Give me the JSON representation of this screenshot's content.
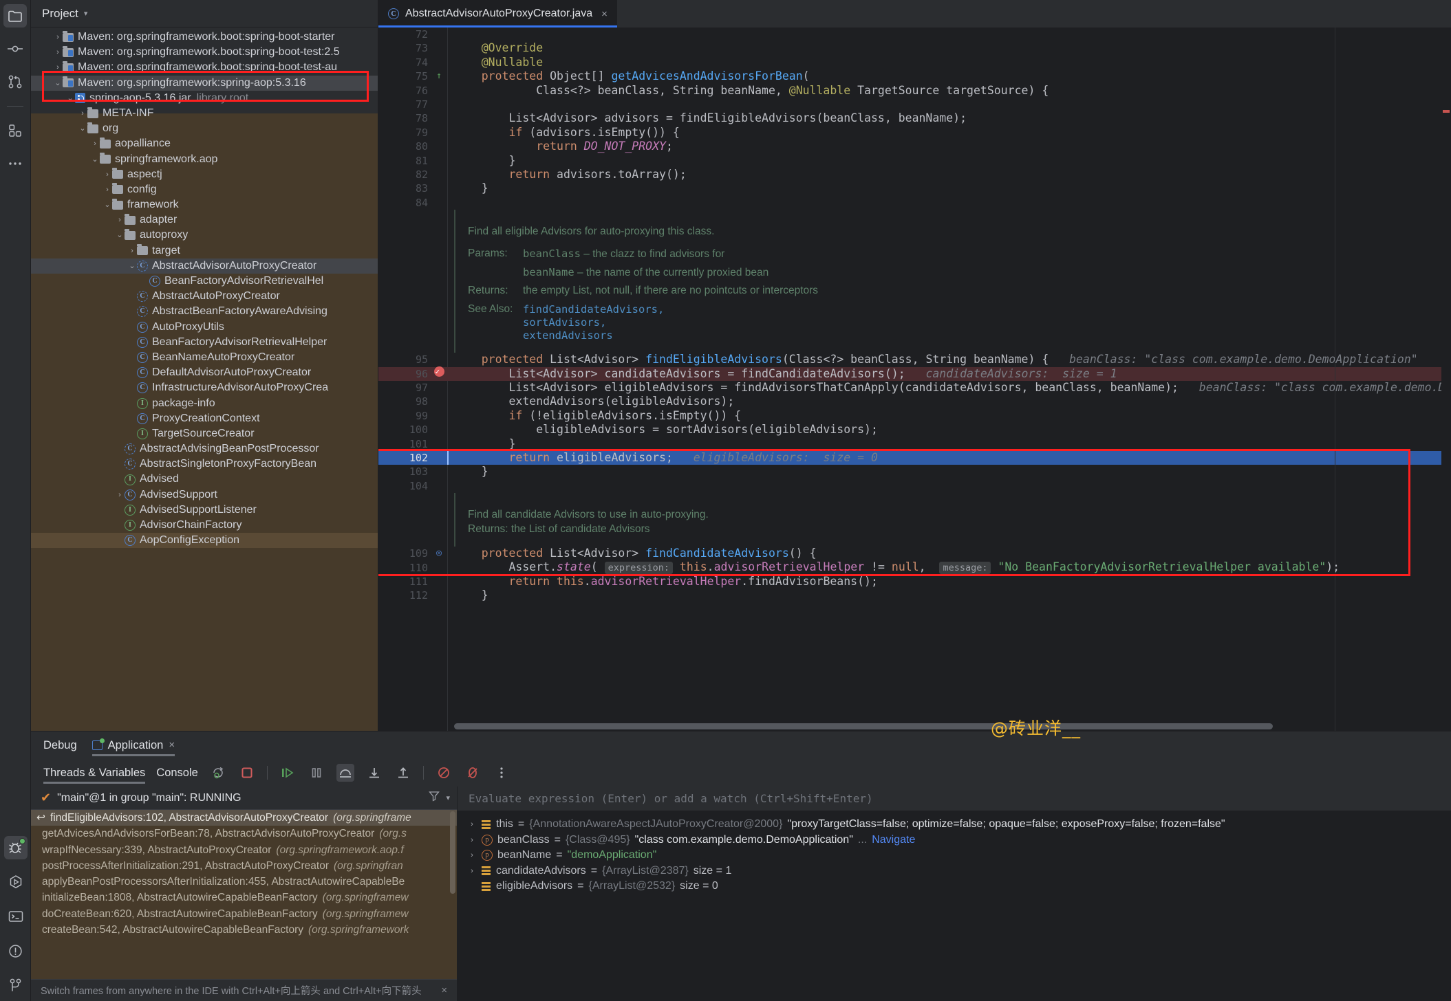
{
  "rail": {
    "top_items": [
      {
        "name": "project-icon",
        "glyph": "folder"
      },
      {
        "name": "commit-icon",
        "glyph": "commit"
      },
      {
        "name": "pull-requests-icon",
        "glyph": "branch"
      },
      {
        "name": "services-icon",
        "glyph": "grid"
      },
      {
        "name": "more-icon",
        "glyph": "dots"
      }
    ],
    "bottom_items": [
      {
        "name": "debug-icon",
        "glyph": "bug"
      },
      {
        "name": "run-icon",
        "glyph": "run"
      },
      {
        "name": "terminal-icon",
        "glyph": "terminal"
      },
      {
        "name": "problems-icon",
        "glyph": "problems"
      },
      {
        "name": "version-control-icon",
        "glyph": "vcs"
      }
    ]
  },
  "project": {
    "title": "Project",
    "tree": [
      {
        "indent": 1,
        "arrow": "collapsed",
        "icon": "maven-folder",
        "label": "Maven: org.springframework.boot:spring-boot-starter",
        "sub": ""
      },
      {
        "indent": 1,
        "arrow": "collapsed",
        "icon": "maven-folder",
        "label": "Maven: org.springframework.boot:spring-boot-test:2.5",
        "sub": ""
      },
      {
        "indent": 1,
        "arrow": "collapsed",
        "icon": "maven-folder",
        "label": "Maven: org.springframework.boot:spring-boot-test-au",
        "sub": ""
      },
      {
        "indent": 1,
        "arrow": "expanded",
        "icon": "maven-folder",
        "label": "Maven: org.springframework:spring-aop:5.3.16",
        "sub": "",
        "selected": "blue"
      },
      {
        "indent": 2,
        "arrow": "expanded",
        "icon": "jar",
        "label": "spring-aop-5.3.16.jar",
        "sub": "library root"
      },
      {
        "indent": 3,
        "arrow": "collapsed",
        "icon": "folder",
        "label": "META-INF",
        "sub": ""
      },
      {
        "indent": 3,
        "arrow": "expanded",
        "icon": "folder",
        "label": "org",
        "sub": ""
      },
      {
        "indent": 4,
        "arrow": "collapsed",
        "icon": "folder",
        "label": "aopalliance",
        "sub": ""
      },
      {
        "indent": 4,
        "arrow": "expanded",
        "icon": "folder",
        "label": "springframework.aop",
        "sub": ""
      },
      {
        "indent": 5,
        "arrow": "collapsed",
        "icon": "folder",
        "label": "aspectj",
        "sub": ""
      },
      {
        "indent": 5,
        "arrow": "collapsed",
        "icon": "folder",
        "label": "config",
        "sub": ""
      },
      {
        "indent": 5,
        "arrow": "expanded",
        "icon": "folder",
        "label": "framework",
        "sub": ""
      },
      {
        "indent": 6,
        "arrow": "collapsed",
        "icon": "folder",
        "label": "adapter",
        "sub": ""
      },
      {
        "indent": 6,
        "arrow": "expanded",
        "icon": "folder",
        "label": "autoproxy",
        "sub": ""
      },
      {
        "indent": 7,
        "arrow": "collapsed",
        "icon": "folder",
        "label": "target",
        "sub": ""
      },
      {
        "indent": 7,
        "arrow": "expanded",
        "icon": "class-abstract",
        "label": "AbstractAdvisorAutoProxyCreator",
        "sub": "",
        "selected": "gray"
      },
      {
        "indent": 8,
        "arrow": "none",
        "icon": "class",
        "label": "BeanFactoryAdvisorRetrievalHel",
        "sub": ""
      },
      {
        "indent": 7,
        "arrow": "none",
        "icon": "class-abstract",
        "label": "AbstractAutoProxyCreator",
        "sub": ""
      },
      {
        "indent": 7,
        "arrow": "none",
        "icon": "class-abstract",
        "label": "AbstractBeanFactoryAwareAdvising",
        "sub": ""
      },
      {
        "indent": 7,
        "arrow": "none",
        "icon": "class",
        "label": "AutoProxyUtils",
        "sub": ""
      },
      {
        "indent": 7,
        "arrow": "none",
        "icon": "class",
        "label": "BeanFactoryAdvisorRetrievalHelper",
        "sub": ""
      },
      {
        "indent": 7,
        "arrow": "none",
        "icon": "class",
        "label": "BeanNameAutoProxyCreator",
        "sub": ""
      },
      {
        "indent": 7,
        "arrow": "none",
        "icon": "class",
        "label": "DefaultAdvisorAutoProxyCreator",
        "sub": ""
      },
      {
        "indent": 7,
        "arrow": "none",
        "icon": "class",
        "label": "InfrastructureAdvisorAutoProxyCrea",
        "sub": ""
      },
      {
        "indent": 7,
        "arrow": "none",
        "icon": "interface",
        "label": "package-info",
        "sub": ""
      },
      {
        "indent": 7,
        "arrow": "none",
        "icon": "class",
        "label": "ProxyCreationContext",
        "sub": ""
      },
      {
        "indent": 7,
        "arrow": "none",
        "icon": "interface",
        "label": "TargetSourceCreator",
        "sub": ""
      },
      {
        "indent": 6,
        "arrow": "none",
        "icon": "class-abstract",
        "label": "AbstractAdvisingBeanPostProcessor",
        "sub": ""
      },
      {
        "indent": 6,
        "arrow": "none",
        "icon": "class-abstract",
        "label": "AbstractSingletonProxyFactoryBean",
        "sub": ""
      },
      {
        "indent": 6,
        "arrow": "none",
        "icon": "interface",
        "label": "Advised",
        "sub": ""
      },
      {
        "indent": 6,
        "arrow": "collapsed",
        "icon": "class",
        "label": "AdvisedSupport",
        "sub": ""
      },
      {
        "indent": 6,
        "arrow": "none",
        "icon": "interface",
        "label": "AdvisedSupportListener",
        "sub": ""
      },
      {
        "indent": 6,
        "arrow": "none",
        "icon": "interface",
        "label": "AdvisorChainFactory",
        "sub": ""
      },
      {
        "indent": 6,
        "arrow": "none",
        "icon": "class",
        "label": "AopConfigException",
        "sub": "",
        "selected": "brown"
      }
    ]
  },
  "editor": {
    "tab_label": "AbstractAdvisorAutoProxyCreator.java",
    "tab_close": "×",
    "lines": [
      {
        "num": "72",
        "gutter": "",
        "tokens": []
      },
      {
        "num": "73",
        "gutter": "",
        "tokens": [
          {
            "c": "ann",
            "t": "    @Override"
          }
        ]
      },
      {
        "num": "74",
        "gutter": "",
        "tokens": [
          {
            "c": "ann",
            "t": "    @Nullable"
          }
        ]
      },
      {
        "num": "75",
        "gutter": "override",
        "tokens": [
          {
            "c": "kw",
            "t": "    protected "
          },
          {
            "c": "txt",
            "t": "Object[] "
          },
          {
            "c": "mth",
            "t": "getAdvicesAndAdvisorsForBean"
          },
          {
            "c": "txt",
            "t": "("
          }
        ]
      },
      {
        "num": "76",
        "gutter": "",
        "tokens": [
          {
            "c": "txt",
            "t": "            Class<?> beanClass, String beanName, "
          },
          {
            "c": "ann",
            "t": "@Nullable "
          },
          {
            "c": "txt",
            "t": "TargetSource targetSource) {"
          }
        ]
      },
      {
        "num": "77",
        "gutter": "",
        "tokens": []
      },
      {
        "num": "78",
        "gutter": "",
        "tokens": [
          {
            "c": "txt",
            "t": "        List<Advisor> advisors = findEligibleAdvisors(beanClass, beanName);"
          }
        ]
      },
      {
        "num": "79",
        "gutter": "",
        "tokens": [
          {
            "c": "kw",
            "t": "        if "
          },
          {
            "c": "txt",
            "t": "(advisors.isEmpty()) {"
          }
        ]
      },
      {
        "num": "80",
        "gutter": "",
        "tokens": [
          {
            "c": "kw",
            "t": "            return "
          },
          {
            "c": "sfld",
            "t": "DO_NOT_PROXY"
          },
          {
            "c": "txt",
            "t": ";"
          }
        ]
      },
      {
        "num": "81",
        "gutter": "",
        "tokens": [
          {
            "c": "txt",
            "t": "        }"
          }
        ]
      },
      {
        "num": "82",
        "gutter": "",
        "tokens": [
          {
            "c": "kw",
            "t": "        return "
          },
          {
            "c": "txt",
            "t": "advisors.toArray();"
          }
        ]
      },
      {
        "num": "83",
        "gutter": "",
        "tokens": [
          {
            "c": "txt",
            "t": "    }"
          }
        ]
      },
      {
        "num": "84",
        "gutter": "",
        "tokens": []
      }
    ],
    "javadoc1": {
      "summary": "Find all eligible Advisors for auto-proxying this class.",
      "params_label": "Params:",
      "params": [
        {
          "name": "beanClass",
          "desc": " – the clazz to find advisors for"
        },
        {
          "name": "beanName",
          "desc": " – the name of the currently proxied bean"
        }
      ],
      "returns_label": "Returns:",
      "returns": "the empty List, not null, if there are no pointcuts or interceptors",
      "seealso_label": "See Also:",
      "seealso": [
        "findCandidateAdvisors,",
        "sortAdvisors,",
        "extendAdvisors"
      ]
    },
    "hl_lines": [
      {
        "num": "95",
        "gutter": "",
        "tokens": [
          {
            "c": "kw",
            "t": "    protected "
          },
          {
            "c": "txt",
            "t": "List<Advisor> "
          },
          {
            "c": "mth",
            "t": "findEligibleAdvisors"
          },
          {
            "c": "txt",
            "t": "(Class<?> beanClass, String beanName) {"
          },
          {
            "c": "hint",
            "t": "   beanClass: \"class com.example.demo.DemoApplication\"    b"
          }
        ]
      },
      {
        "num": "96",
        "gutter": "breakpoint",
        "hl": "red",
        "tokens": [
          {
            "c": "txt",
            "t": "        List<Advisor> candidateAdvisors = findCandidateAdvisors();"
          },
          {
            "c": "hint",
            "t": "   candidateAdvisors:  size = 1"
          }
        ]
      },
      {
        "num": "97",
        "gutter": "",
        "tokens": [
          {
            "c": "txt",
            "t": "        List<Advisor> eligibleAdvisors = findAdvisorsThatCanApply(candidateAdvisors, beanClass, beanName);"
          },
          {
            "c": "hint",
            "t": "   beanClass: \"class com.example.demo.De"
          }
        ]
      },
      {
        "num": "98",
        "gutter": "",
        "tokens": [
          {
            "c": "txt",
            "t": "        extendAdvisors(eligibleAdvisors);"
          }
        ]
      },
      {
        "num": "99",
        "gutter": "",
        "tokens": [
          {
            "c": "kw",
            "t": "        if "
          },
          {
            "c": "txt",
            "t": "(!eligibleAdvisors.isEmpty()) {"
          }
        ]
      },
      {
        "num": "100",
        "gutter": "",
        "tokens": [
          {
            "c": "txt",
            "t": "            eligibleAdvisors = sortAdvisors(eligibleAdvisors);"
          }
        ]
      },
      {
        "num": "101",
        "gutter": "",
        "tokens": [
          {
            "c": "txt",
            "t": "        }"
          }
        ]
      },
      {
        "num": "102",
        "gutter": "",
        "hl": "blue",
        "tokens": [
          {
            "c": "kw",
            "t": "        return "
          },
          {
            "c": "txt",
            "t": "eligibleAdvisors;"
          },
          {
            "c": "hint",
            "t": "   eligibleAdvisors:  size = 0"
          }
        ]
      },
      {
        "num": "103",
        "gutter": "",
        "tokens": [
          {
            "c": "txt",
            "t": "    }"
          }
        ]
      },
      {
        "num": "104",
        "gutter": "",
        "tokens": []
      }
    ],
    "javadoc2": {
      "summary": "Find all candidate Advisors to use in auto-proxying.",
      "returns": "Returns: the List of candidate Advisors"
    },
    "tail_lines": [
      {
        "num": "109",
        "gutter": "at",
        "tokens": [
          {
            "c": "kw",
            "t": "    protected "
          },
          {
            "c": "txt",
            "t": "List<Advisor> "
          },
          {
            "c": "mth",
            "t": "findCandidateAdvisors"
          },
          {
            "c": "txt",
            "t": "() {"
          }
        ]
      },
      {
        "num": "110",
        "gutter": "",
        "tokens": [
          {
            "c": "txt",
            "t": "        Assert."
          },
          {
            "c": "sfld",
            "t": "state"
          },
          {
            "c": "txt",
            "t": "( "
          },
          {
            "c": "chip",
            "t": "expression:"
          },
          {
            "c": "txt",
            "t": " "
          },
          {
            "c": "kw",
            "t": "this"
          },
          {
            "c": "txt",
            "t": "."
          },
          {
            "c": "fld",
            "t": "advisorRetrievalHelper"
          },
          {
            "c": "txt",
            "t": " != "
          },
          {
            "c": "kw",
            "t": "null"
          },
          {
            "c": "txt",
            "t": ",  "
          },
          {
            "c": "chip",
            "t": "message:"
          },
          {
            "c": "str",
            "t": " \"No BeanFactoryAdvisorRetrievalHelper available\""
          },
          {
            "c": "txt",
            "t": ");"
          }
        ]
      },
      {
        "num": "111",
        "gutter": "",
        "tokens": [
          {
            "c": "kw",
            "t": "        return this"
          },
          {
            "c": "txt",
            "t": "."
          },
          {
            "c": "fld",
            "t": "advisorRetrievalHelper"
          },
          {
            "c": "txt",
            "t": ".findAdvisorBeans();"
          }
        ]
      },
      {
        "num": "112",
        "gutter": "",
        "tokens": [
          {
            "c": "txt",
            "t": "    }"
          }
        ]
      }
    ]
  },
  "watermark": "@砖业洋__",
  "debug": {
    "tabs": [
      {
        "label": "Debug",
        "icon": "",
        "active": false
      },
      {
        "label": "Application",
        "icon": "application-icon",
        "close": "×",
        "active": true
      }
    ],
    "subtabs": [
      {
        "label": "Threads & Variables",
        "active": true
      },
      {
        "label": "Console",
        "active": false
      }
    ],
    "toolbar_icons": [
      {
        "name": "rerun-debug-icon",
        "glyph": "rerun"
      },
      {
        "name": "stop-icon",
        "glyph": "stop"
      },
      {
        "name": "resume-program-icon",
        "glyph": "resume"
      },
      {
        "name": "pause-program-icon",
        "glyph": "pause"
      },
      {
        "name": "step-over-icon",
        "glyph": "step-over",
        "active": true
      },
      {
        "name": "step-into-icon",
        "glyph": "step-into"
      },
      {
        "name": "step-out-icon",
        "glyph": "step-out"
      },
      {
        "name": "view-breakpoints-icon",
        "glyph": "breakpoints"
      },
      {
        "name": "mute-breakpoints-icon",
        "glyph": "mute"
      },
      {
        "name": "more-options-icon",
        "glyph": "kebab"
      }
    ],
    "thread_status": "\"main\"@1 in group \"main\": RUNNING",
    "thread_filter_icon": "filter-icon",
    "thread_dropdown_icon": "chevron-down-icon",
    "frames": [
      {
        "text": "findEligibleAdvisors:102, AbstractAdvisorAutoProxyCreator ",
        "italic": "(org.springframe",
        "first": true
      },
      {
        "text": "getAdvicesAndAdvisorsForBean:78, AbstractAdvisorAutoProxyCreator ",
        "italic": "(org.s"
      },
      {
        "text": "wrapIfNecessary:339, AbstractAutoProxyCreator ",
        "italic": "(org.springframework.aop.f"
      },
      {
        "text": "postProcessAfterInitialization:291, AbstractAutoProxyCreator ",
        "italic": "(org.springfran"
      },
      {
        "text": "applyBeanPostProcessorsAfterInitialization:455, AbstractAutowireCapableBe",
        "italic": ""
      },
      {
        "text": "initializeBean:1808, AbstractAutowireCapableBeanFactory ",
        "italic": "(org.springframew"
      },
      {
        "text": "doCreateBean:620, AbstractAutowireCapableBeanFactory ",
        "italic": "(org.springframew"
      },
      {
        "text": "createBean:542, AbstractAutowireCapableBeanFactory ",
        "italic": "(org.springframework"
      }
    ],
    "hint_bar": "Switch frames from anywhere in the IDE with Ctrl+Alt+向上箭头 and Ctrl+Alt+向下箭头",
    "hint_close": "×",
    "eval_placeholder": "Evaluate expression (Enter) or add a watch (Ctrl+Shift+Enter)",
    "variables": [
      {
        "arrow": "collapsed",
        "icon": "list-icon",
        "name": "this",
        "eq": " = ",
        "ref": "{AnnotationAwareAspectJAutoProxyCreator@2000}",
        "value": "\"proxyTargetClass=false; optimize=false; opaque=false; exposeProxy=false; frozen=false\"",
        "value_style": "plain"
      },
      {
        "arrow": "collapsed",
        "icon": "param-icon",
        "name": "beanClass",
        "eq": " = ",
        "ref": "{Class@495}",
        "value": "\"class com.example.demo.DemoApplication\"",
        "suffix": "...",
        "link": "Navigate",
        "value_style": "plain"
      },
      {
        "arrow": "collapsed",
        "icon": "param-icon",
        "name": "beanName",
        "eq": " = ",
        "ref": "",
        "value": "\"demoApplication\"",
        "value_style": "green"
      },
      {
        "arrow": "collapsed",
        "icon": "list-icon",
        "name": "candidateAdvisors",
        "eq": " = ",
        "ref": "{ArrayList@2387}",
        "value": "size = 1",
        "value_style": "size"
      },
      {
        "arrow": "none",
        "icon": "list-icon",
        "name": "eligibleAdvisors",
        "eq": " = ",
        "ref": "{ArrayList@2532}",
        "value": "size = 0",
        "value_style": "size"
      }
    ]
  },
  "colors": {
    "accent": "#3574f0",
    "highlight_red": "#ff1f1f",
    "selection_blue": "#2f5ca8",
    "jar_brown": "#463a2a",
    "watermark": "#f5bc31"
  }
}
